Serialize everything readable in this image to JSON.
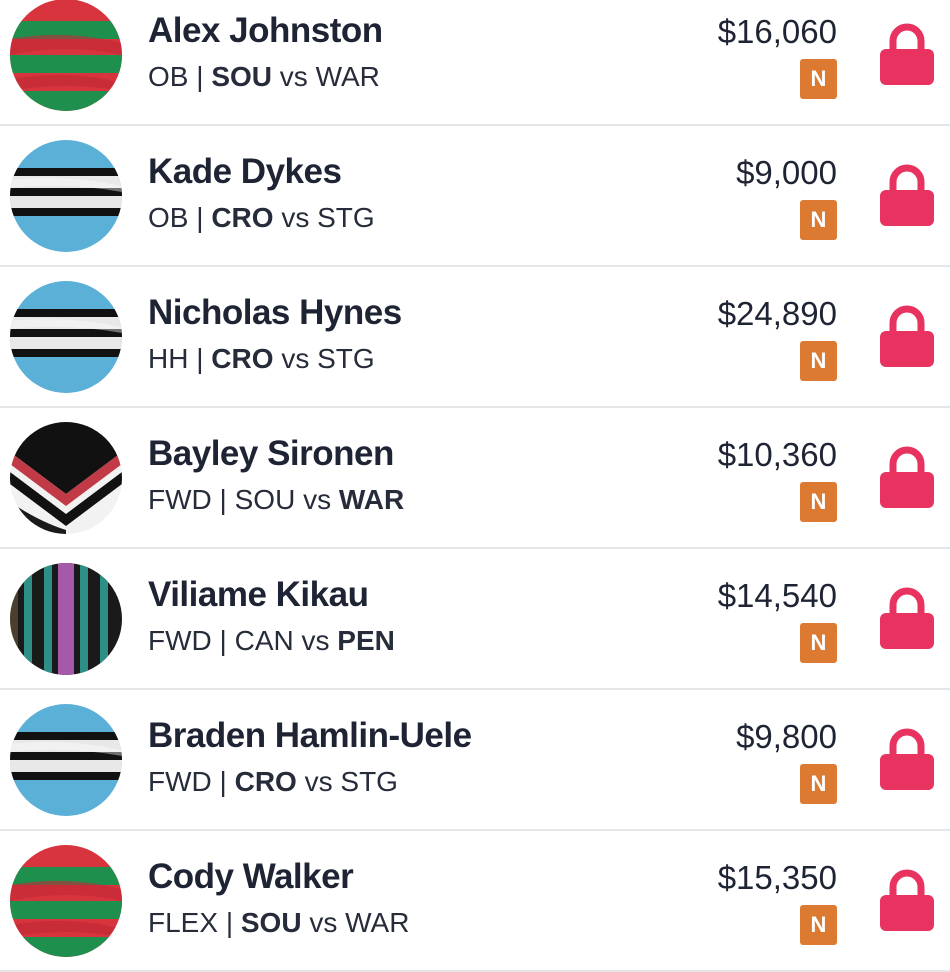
{
  "players": [
    {
      "name": "Alex Johnston",
      "position": "OB",
      "separator": "|",
      "home": "SOU",
      "vs": "vs",
      "away": "WAR",
      "bold_team": "home",
      "price": "$16,060",
      "badge": "N",
      "avatar": "souths-jersey-icon"
    },
    {
      "name": "Kade Dykes",
      "position": "OB",
      "separator": "|",
      "home": "CRO",
      "vs": "vs",
      "away": "STG",
      "bold_team": "home",
      "price": "$9,000",
      "badge": "N",
      "avatar": "cronulla-jersey-icon"
    },
    {
      "name": "Nicholas Hynes",
      "position": "HH",
      "separator": "|",
      "home": "CRO",
      "vs": "vs",
      "away": "STG",
      "bold_team": "home",
      "price": "$24,890",
      "badge": "N",
      "avatar": "cronulla-jersey-icon"
    },
    {
      "name": "Bayley Sironen",
      "position": "FWD",
      "separator": "|",
      "home": "SOU",
      "vs": "vs",
      "away": "WAR",
      "bold_team": "away",
      "price": "$10,360",
      "badge": "N",
      "avatar": "warriors-jersey-icon"
    },
    {
      "name": "Viliame Kikau",
      "position": "FWD",
      "separator": "|",
      "home": "CAN",
      "vs": "vs",
      "away": "PEN",
      "bold_team": "away",
      "price": "$14,540",
      "badge": "N",
      "avatar": "panthers-jersey-icon"
    },
    {
      "name": "Braden Hamlin-Uele",
      "position": "FWD",
      "separator": "|",
      "home": "CRO",
      "vs": "vs",
      "away": "STG",
      "bold_team": "home",
      "price": "$9,800",
      "badge": "N",
      "avatar": "cronulla-jersey-icon"
    },
    {
      "name": "Cody Walker",
      "position": "FLEX",
      "separator": "|",
      "home": "SOU",
      "vs": "vs",
      "away": "WAR",
      "bold_team": "home",
      "price": "$15,350",
      "badge": "N",
      "avatar": "souths-jersey-icon"
    }
  ],
  "colors": {
    "lock": "#e8325f",
    "badge": "#dc7a32",
    "divider": "#e4e6ea",
    "text": "#1e2433"
  },
  "icons": {
    "lock": "lock-icon"
  }
}
